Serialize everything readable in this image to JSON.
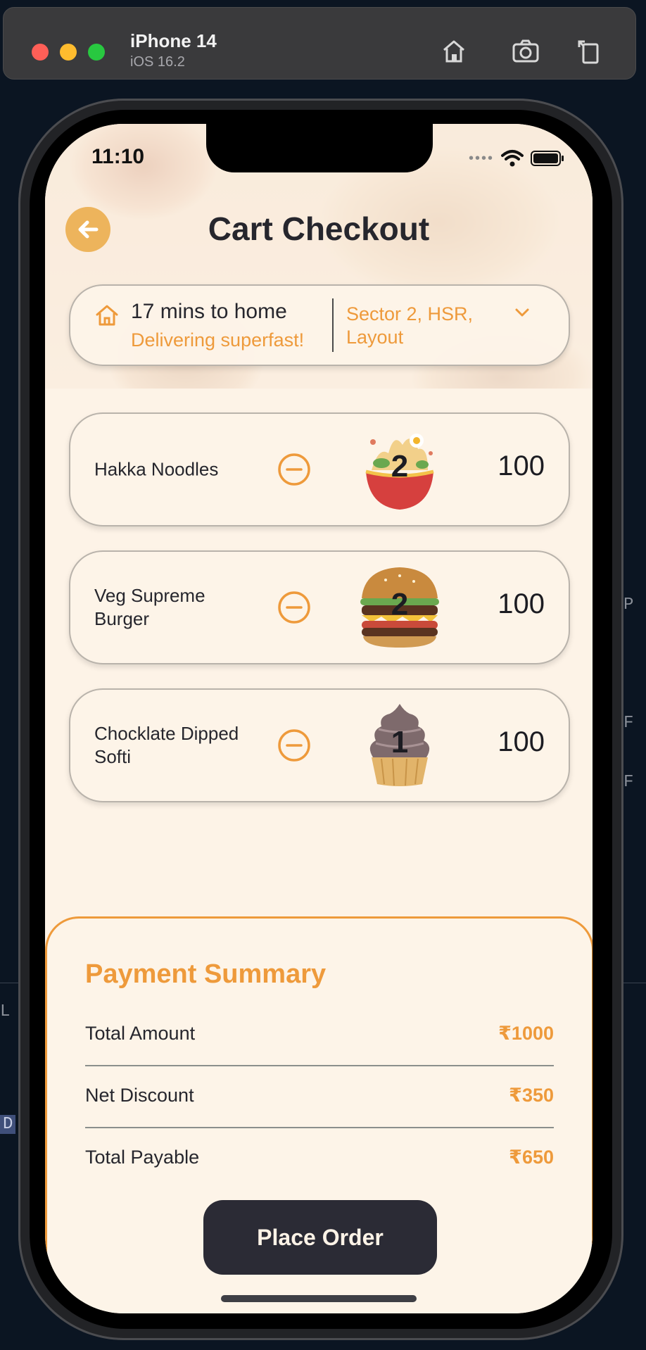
{
  "simulator": {
    "device_name": "iPhone 14",
    "os_version": "iOS 16.2",
    "buttons": [
      {
        "icon": "home-icon"
      },
      {
        "icon": "camera-icon"
      },
      {
        "icon": "rotate-icon"
      }
    ]
  },
  "background_fragments": [
    "P",
    "F",
    "F",
    "L",
    "D"
  ],
  "status_bar": {
    "time": "11:10"
  },
  "header": {
    "title": "Cart Checkout",
    "back_icon": "arrow-left-icon"
  },
  "delivery": {
    "eta": "17 mins to home",
    "subtitle": "Delivering superfast!",
    "address": "Sector 2, HSR, Layout"
  },
  "cart_items": [
    {
      "name": "Hakka Noodles",
      "quantity": "2",
      "price": "100",
      "image": "noodles-bowl"
    },
    {
      "name": "Veg Supreme Burger",
      "quantity": "2",
      "price": "100",
      "image": "burger"
    },
    {
      "name": "Chocklate Dipped Softi",
      "quantity": "1",
      "price": "100",
      "image": "softi-cone"
    }
  ],
  "payment_summary": {
    "title": "Payment Summary",
    "rows": [
      {
        "label": "Total Amount",
        "value": "₹1000"
      },
      {
        "label": "Net Discount",
        "value": "₹350"
      },
      {
        "label": "Total Payable",
        "value": "₹650"
      }
    ],
    "button_label": "Place Order"
  },
  "colors": {
    "accent": "#ee9a3b",
    "back_button": "#edb45c",
    "screen_bg": "#fdf3e7",
    "dark_button": "#2b2b35"
  }
}
